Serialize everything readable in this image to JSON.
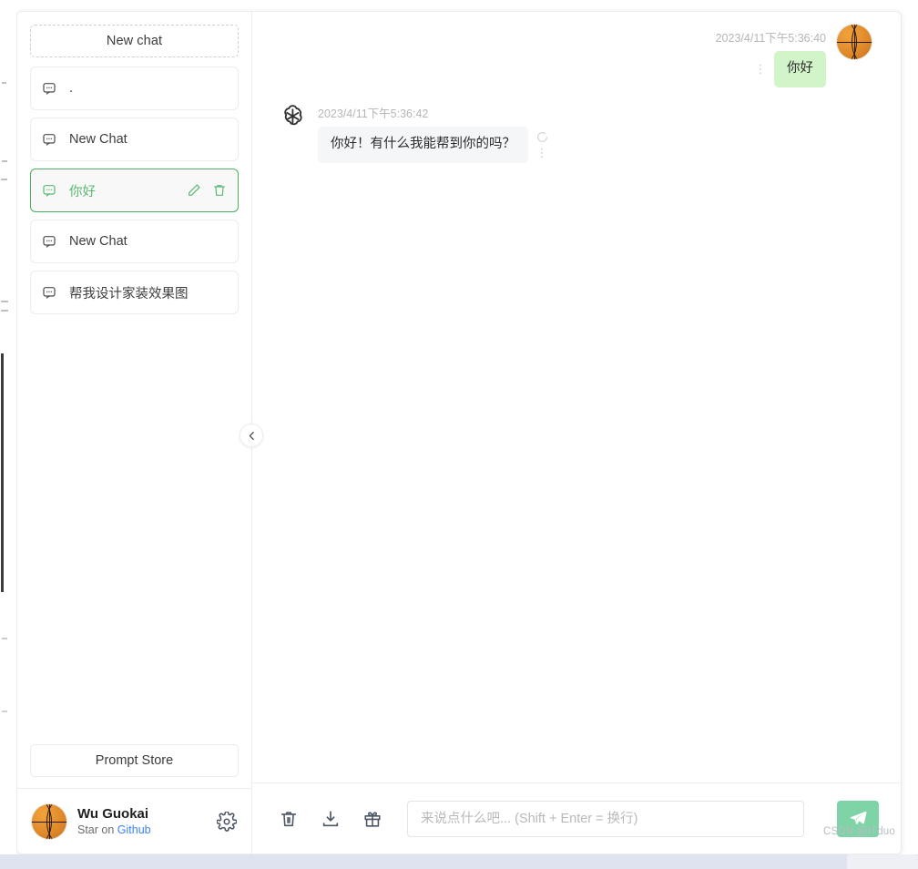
{
  "sidebar": {
    "new_chat_label": "New chat",
    "chats": [
      {
        "title": ".",
        "icon": "chat-bubble-icon",
        "active": false
      },
      {
        "title": "New Chat",
        "icon": "chat-bubble-icon",
        "active": false
      },
      {
        "title": "你好",
        "icon": "chat-bubble-icon",
        "active": true
      },
      {
        "title": "New Chat",
        "icon": "chat-bubble-icon",
        "active": false
      },
      {
        "title": "帮我设计家装效果图",
        "icon": "chat-bubble-icon",
        "active": false
      }
    ],
    "item_actions": {
      "edit_label": "edit-icon",
      "delete_label": "trash-icon"
    },
    "prompt_store_label": "Prompt Store",
    "user": {
      "name": "Wu Guokai",
      "sub_prefix": "Star on ",
      "sub_link": "Github",
      "avatar": "basketball-avatar",
      "settings_icon": "gear-icon"
    },
    "collapse_icon": "chevron-left-icon"
  },
  "chat": {
    "messages": [
      {
        "role": "user",
        "time": "2023/4/11下午5:36:40",
        "text": "你好",
        "avatar": "basketball-avatar",
        "menu_icon": "more-vertical-icon"
      },
      {
        "role": "assistant",
        "time": "2023/4/11下午5:36:42",
        "text": "你好！有什么我能帮到你的吗？",
        "avatar": "openai-logo-icon",
        "menu_icon": "more-vertical-icon",
        "regen_icon": "refresh-circle-icon"
      }
    ]
  },
  "composer": {
    "tools": [
      {
        "name": "clear-conversation",
        "icon": "trash-icon"
      },
      {
        "name": "export-conversation",
        "icon": "download-icon"
      },
      {
        "name": "gift",
        "icon": "gift-icon"
      }
    ],
    "input_value": "",
    "input_placeholder": "来说点什么吧... (Shift + Enter = 换行)",
    "send_icon": "send-plane-icon"
  },
  "watermark": {
    "text": "CSDN @ITduo"
  },
  "colors": {
    "accent_green": "#4caf62",
    "send_green": "#7ed3a7",
    "user_bubble": "#d2f4c9",
    "bot_bubble": "#f4f6f8",
    "link_blue": "#3b82f6",
    "muted_text": "#b6b6b6"
  }
}
